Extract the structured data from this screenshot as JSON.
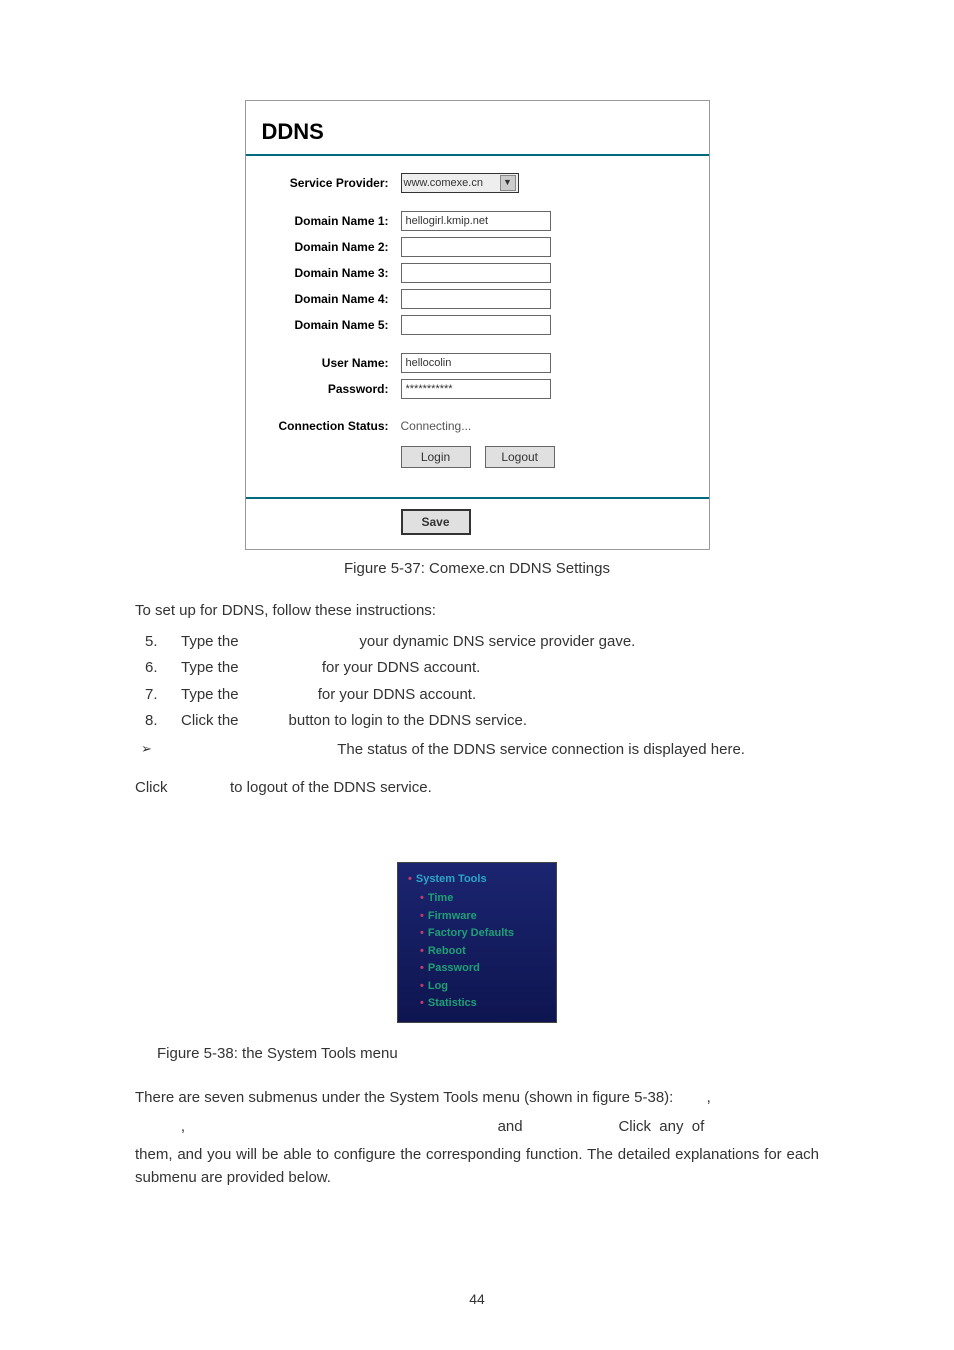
{
  "ddns": {
    "title": "DDNS",
    "labels": {
      "service_provider": "Service Provider:",
      "domain1": "Domain Name 1:",
      "domain2": "Domain Name 2:",
      "domain3": "Domain Name 3:",
      "domain4": "Domain Name 4:",
      "domain5": "Domain Name 5:",
      "user": "User Name:",
      "password": "Password:",
      "conn_status": "Connection Status:"
    },
    "values": {
      "provider": "www.comexe.cn",
      "domain1": "hellogirl.kmip.net",
      "domain2": "",
      "domain3": "",
      "domain4": "",
      "domain5": "",
      "user": "hellocolin",
      "password": "***********",
      "conn_status": "Connecting..."
    },
    "buttons": {
      "login": "Login",
      "logout": "Logout",
      "save": "Save"
    }
  },
  "captions": {
    "fig37": "Figure 5-37: Comexe.cn DDNS Settings",
    "fig38": "Figure 5-38: the System Tools menu"
  },
  "text": {
    "intro": "To set up for DDNS, follow these instructions:",
    "step5": "Type the                             your dynamic DNS service provider gave.",
    "step6": "Type the                    for your DDNS account.",
    "step7": "Type the                   for your DDNS account.",
    "step8": "Click the            button to login to the DDNS service.",
    "bullet": "                                       The status of the DDNS service connection is displayed here.",
    "logout_line": "Click               to logout of the DDNS service.",
    "para1": "There are seven submenus under the System Tools menu (shown in figure 5-38):        ,",
    "para2": "           ,                                                                           and                       Click  any  of",
    "para3": "them,  and  you  will  be  able  to  configure  the  corresponding  function.  The  detailed explanations for each submenu are provided below."
  },
  "steps": {
    "n5": "5.",
    "n6": "6.",
    "n7": "7.",
    "n8": "8."
  },
  "menu": {
    "top": "System Tools",
    "items": [
      "Time",
      "Firmware",
      "Factory Defaults",
      "Reboot",
      "Password",
      "Log",
      "Statistics"
    ]
  },
  "page_num": "44"
}
